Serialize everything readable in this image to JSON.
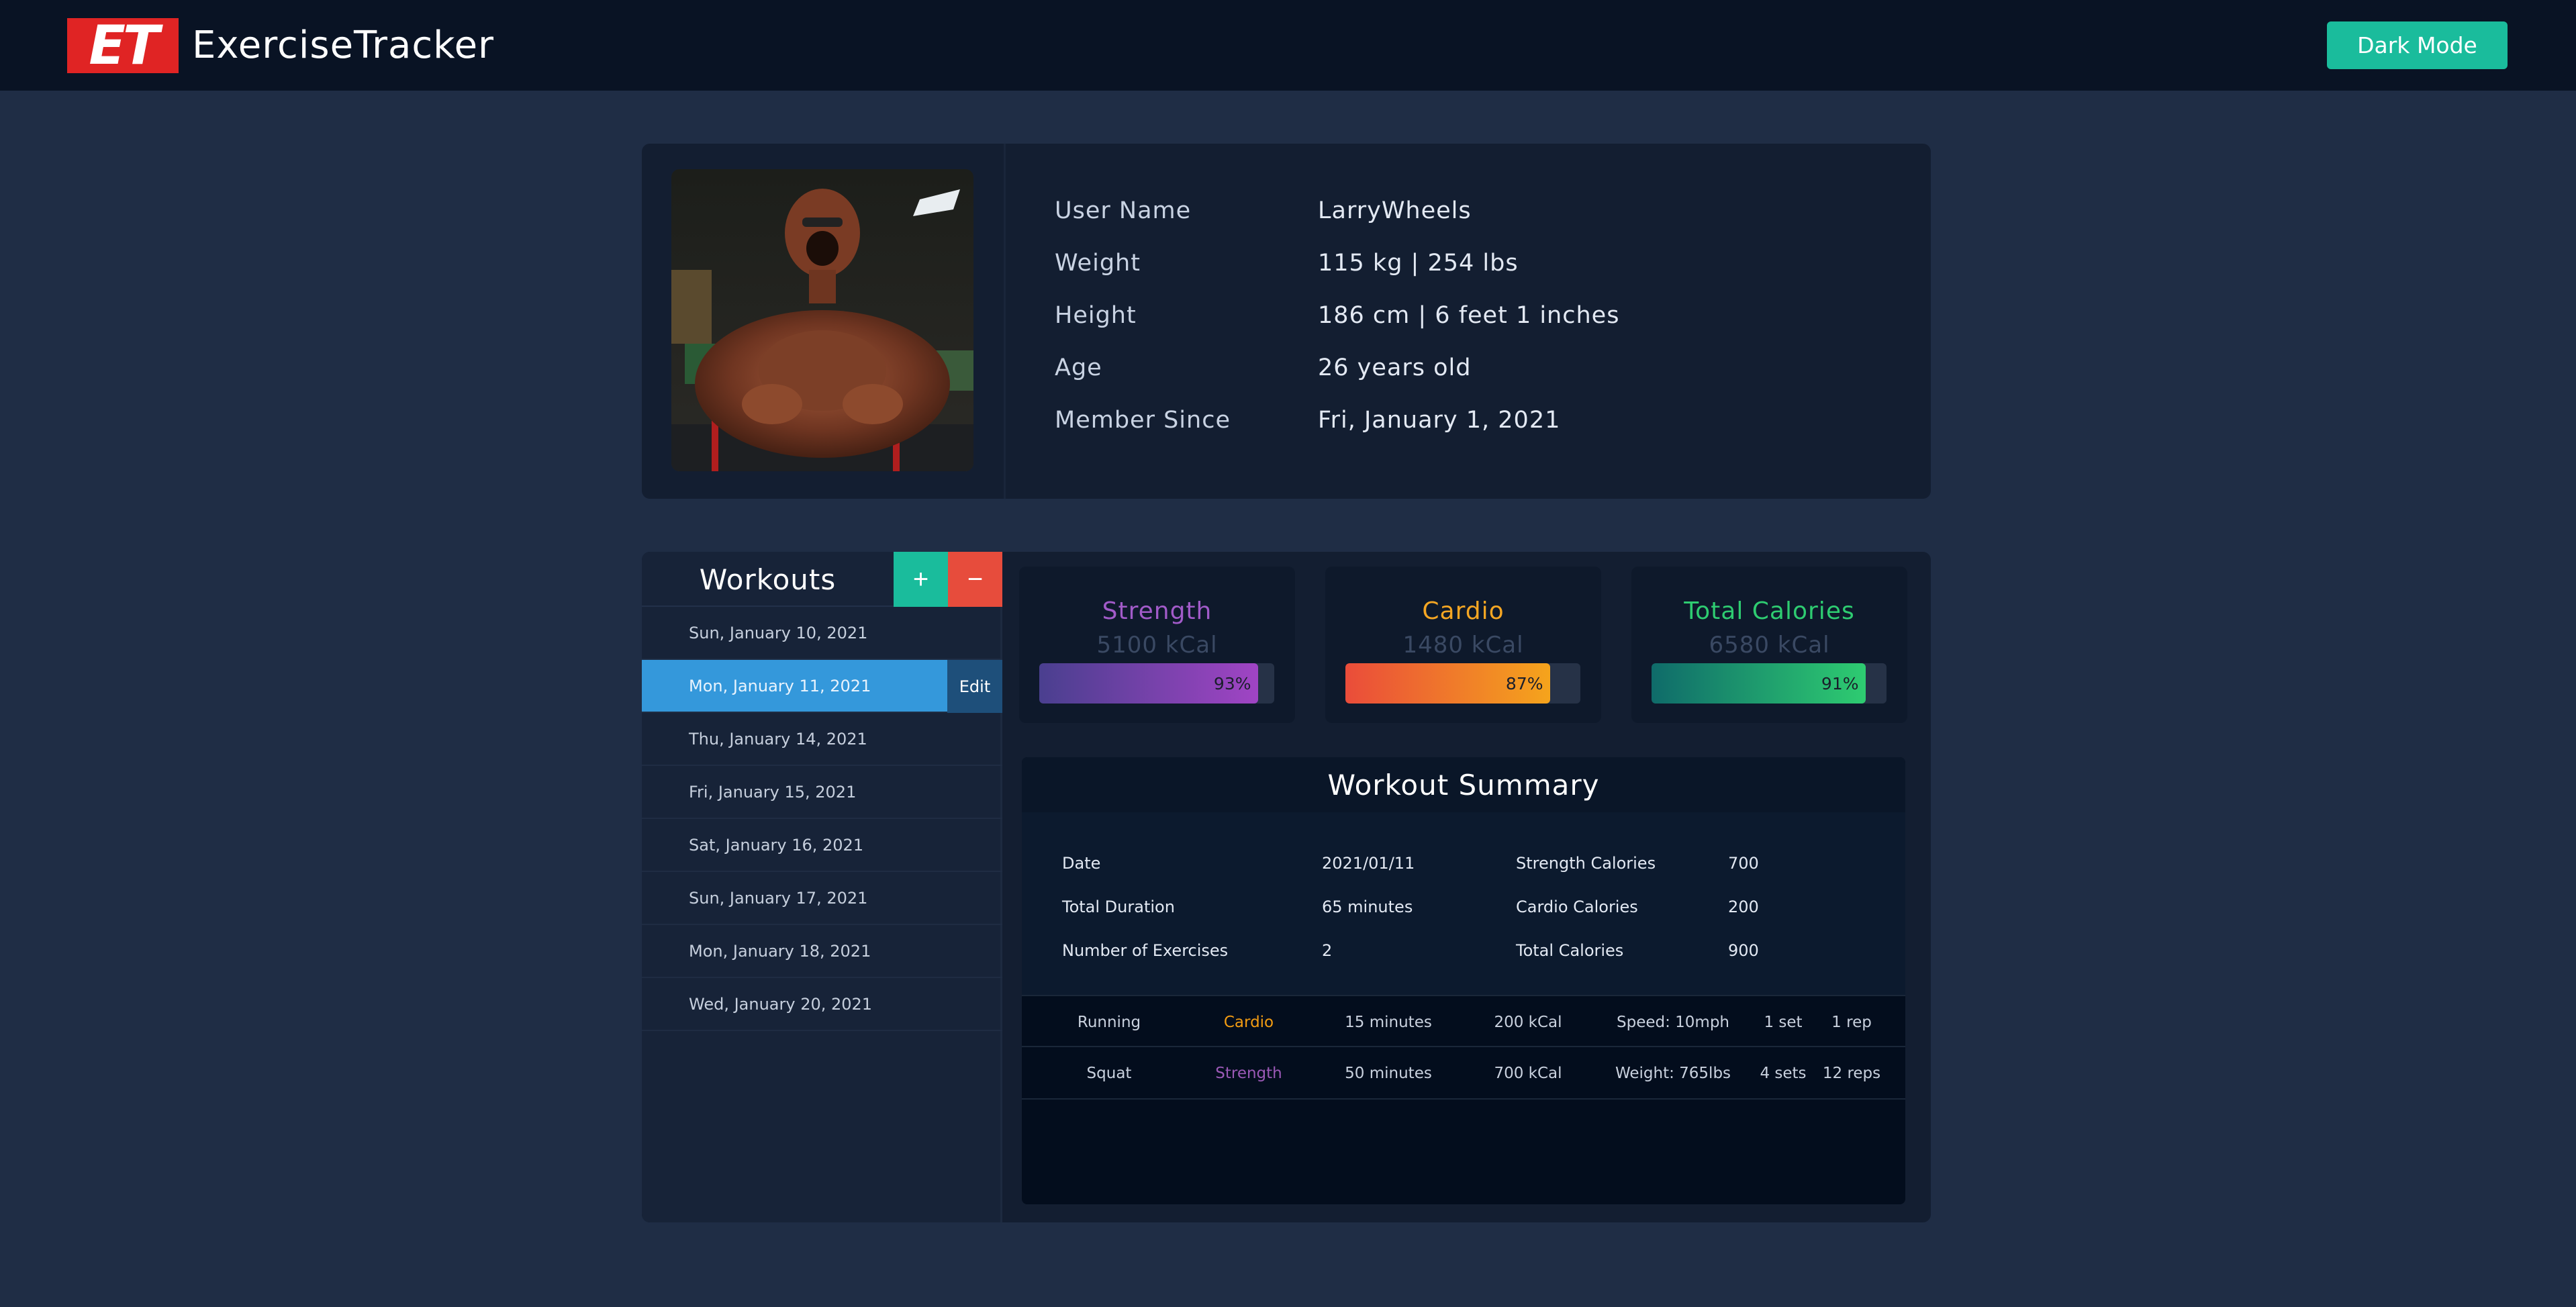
{
  "navbar": {
    "logo_text": "ET",
    "app_name": "ExerciseTracker",
    "dark_mode_label": "Dark Mode"
  },
  "profile": {
    "avatar_icon": "user-photo",
    "fields": [
      {
        "label": "User Name",
        "value": "LarryWheels"
      },
      {
        "label": "Weight",
        "value": "115 kg | 254 lbs"
      },
      {
        "label": "Height",
        "value": "186 cm | 6 feet 1 inches"
      },
      {
        "label": "Age",
        "value": "26 years old"
      },
      {
        "label": "Member Since",
        "value": "Fri, January 1, 2021"
      }
    ]
  },
  "workouts": {
    "title": "Workouts",
    "add_label": "+",
    "remove_label": "−",
    "edit_label": "Edit",
    "selected_index": 1,
    "items": [
      "Sun, January 10, 2021",
      "Mon, January 11, 2021",
      "Thu, January 14, 2021",
      "Fri, January 15, 2021",
      "Sat, January 16, 2021",
      "Sun, January 17, 2021",
      "Mon, January 18, 2021",
      "Wed, January 20, 2021"
    ]
  },
  "stats": [
    {
      "title": "Strength",
      "value": "5100 kCal",
      "percent": 93,
      "percent_label": "93%",
      "color": "#a25bc9",
      "gradient": [
        "#4a3f8f",
        "#a044c4"
      ]
    },
    {
      "title": "Cardio",
      "value": "1480 kCal",
      "percent": 87,
      "percent_label": "87%",
      "color": "#f5a623",
      "gradient": [
        "#ea4c3a",
        "#f5a41c"
      ]
    },
    {
      "title": "Total Calories",
      "value": "6580 kCal",
      "percent": 91,
      "percent_label": "91%",
      "color": "#2ecc71",
      "gradient": [
        "#0f6b6a",
        "#2ecc71"
      ]
    }
  ],
  "summary": {
    "title": "Workout Summary",
    "info_left": [
      {
        "label": "Date",
        "value": "2021/01/11"
      },
      {
        "label": "Total Duration",
        "value": "65 minutes"
      },
      {
        "label": "Number of Exercises",
        "value": "2"
      }
    ],
    "info_right": [
      {
        "label": "Strength Calories",
        "value": "700"
      },
      {
        "label": "Cardio Calories",
        "value": "200"
      },
      {
        "label": "Total Calories",
        "value": "900"
      }
    ],
    "exercises": [
      {
        "name": "Running",
        "type": "Cardio",
        "type_color": "#f39c12",
        "duration": "15 minutes",
        "calories": "200 kCal",
        "detail": "Speed: 10mph",
        "sets": "1 set",
        "reps": "1 rep"
      },
      {
        "name": "Squat",
        "type": "Strength",
        "type_color": "#9b59b6",
        "duration": "50 minutes",
        "calories": "700 kCal",
        "detail": "Weight: 765lbs",
        "sets": "4 sets",
        "reps": "12 reps"
      }
    ]
  }
}
